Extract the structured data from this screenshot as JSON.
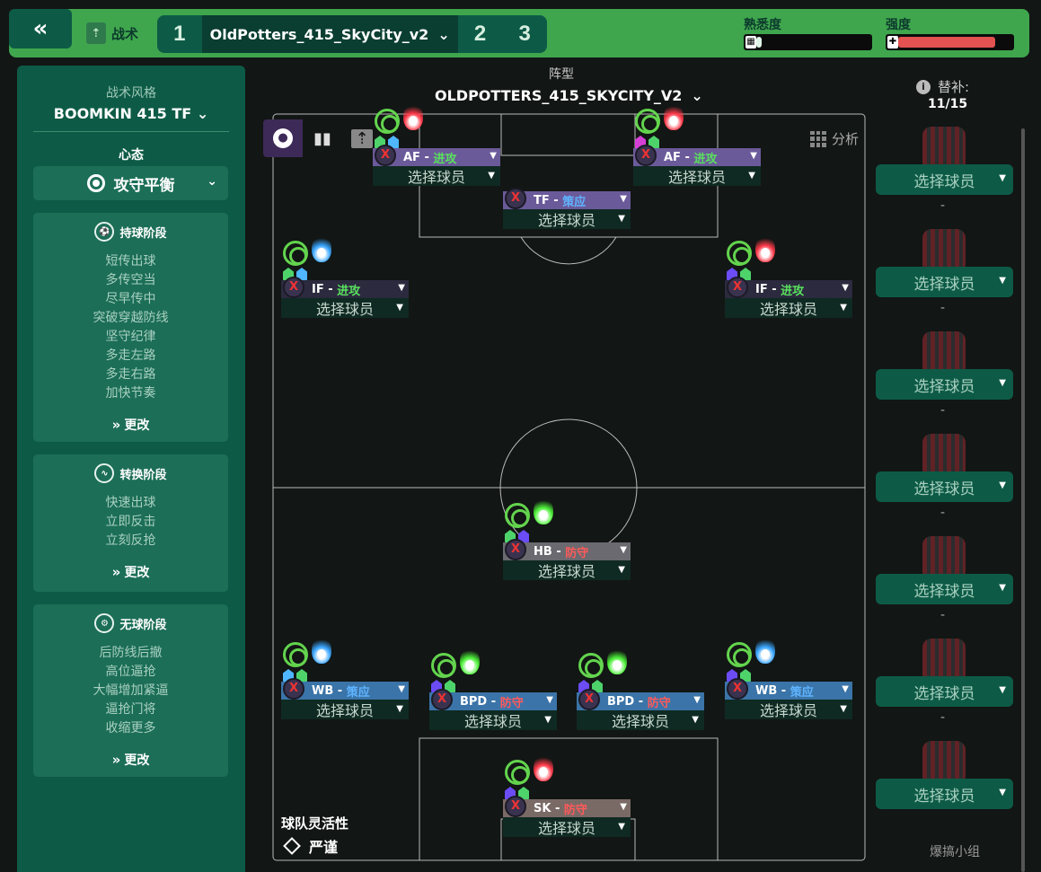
{
  "topbar": {
    "collapse_icon": "«",
    "tactic_label": "战术",
    "slots": [
      "1",
      "2",
      "3"
    ],
    "active_tactic": "OldPotters_415_SkyCity_v2",
    "familiarity_label": "熟悉度",
    "familiarity_value": 0.05,
    "intensity_label": "强度",
    "intensity_value": 0.85,
    "colors": {
      "bar_bg": "#3fa64e",
      "slot_bg": "#0d5b46",
      "intensity": "#e35151",
      "familiarity": "#e0f5e8"
    }
  },
  "sidebar": {
    "style_heading": "战术风格",
    "style_name": "BOOMKIN 415 TF",
    "mentality_heading": "心态",
    "mentality_value": "攻守平衡",
    "phases": [
      {
        "title": "持球阶段",
        "icon": "ball-icon",
        "items": [
          "短传出球",
          "多传空当",
          "尽早传中",
          "突破穿越防线",
          "坚守纪律",
          "多走左路",
          "多走右路",
          "加快节奏"
        ],
        "change": "更改"
      },
      {
        "title": "转换阶段",
        "icon": "transition-icon",
        "items": [
          "快速出球",
          "立即反击",
          "立刻反抢"
        ],
        "change": "更改"
      },
      {
        "title": "无球阶段",
        "icon": "defend-icon",
        "items": [
          "后防线后撤",
          "高位逼抢",
          "大幅增加紧逼",
          "逼抢门将",
          "收缩更多"
        ],
        "change": "更改"
      }
    ]
  },
  "pitch": {
    "formation_heading": "阵型",
    "formation_name": "OLDPOTTERS_415_SKYCITY_V2",
    "analysis_label": "分析",
    "select_player": "选择球员",
    "fluidity_label": "球队灵活性",
    "fluidity_value": "严谨",
    "positions": [
      {
        "id": "af-left",
        "role": "AF",
        "duty": "进攻",
        "duty_type": "att"
      },
      {
        "id": "tf",
        "role": "TF",
        "duty": "策应",
        "duty_type": "sup"
      },
      {
        "id": "af-right",
        "role": "AF",
        "duty": "进攻",
        "duty_type": "att"
      },
      {
        "id": "if-left",
        "role": "IF",
        "duty": "进攻",
        "duty_type": "att"
      },
      {
        "id": "if-right",
        "role": "IF",
        "duty": "进攻",
        "duty_type": "att"
      },
      {
        "id": "hb",
        "role": "HB",
        "duty": "防守",
        "duty_type": "def"
      },
      {
        "id": "wb-left",
        "role": "WB",
        "duty": "策应",
        "duty_type": "sup"
      },
      {
        "id": "bpd-left",
        "role": "BPD",
        "duty": "防守",
        "duty_type": "def"
      },
      {
        "id": "bpd-right",
        "role": "BPD",
        "duty": "防守",
        "duty_type": "def"
      },
      {
        "id": "wb-right",
        "role": "WB",
        "duty": "策应",
        "duty_type": "sup"
      },
      {
        "id": "sk",
        "role": "SK",
        "duty": "防守",
        "duty_type": "def"
      }
    ]
  },
  "subs": {
    "label": "替补:",
    "count": "11/15",
    "button_label": "选择球员",
    "dash": "-"
  },
  "watermark": "爆搞小组"
}
